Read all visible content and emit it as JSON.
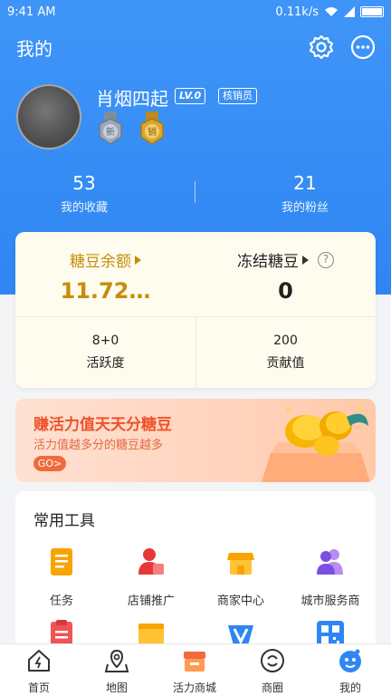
{
  "status": {
    "time": "9:41 AM",
    "network_speed": "0.11k/s"
  },
  "header": {
    "title": "我的",
    "settings_icon": "gear-icon",
    "more_icon": "chat-more-icon"
  },
  "profile": {
    "name": "肖烟四起",
    "level": "LV.0",
    "role": "核销员",
    "medals": [
      {
        "icon": "medal-icon",
        "text": "新",
        "color": "#9aa8b8"
      },
      {
        "icon": "medal-icon",
        "text": "销",
        "color": "#d8a632"
      }
    ]
  },
  "stats": [
    {
      "value": "53",
      "label": "我的收藏"
    },
    {
      "value": "21",
      "label": "我的粉丝"
    }
  ],
  "balance": {
    "sugar_label": "糖豆余额",
    "sugar_value": "11.72…",
    "frozen_label": "冻结糖豆",
    "frozen_value": "0",
    "activity_value": "8+0",
    "activity_label": "活跃度",
    "contribution_value": "200",
    "contribution_label": "贡献值",
    "accent_color": "#c78c0a"
  },
  "promo": {
    "title": "赚活力值天天分糖豆",
    "subtitle": "活力值越多分的糖豆越多",
    "button": "GO>"
  },
  "tools": {
    "title": "常用工具",
    "items": [
      {
        "label": "任务",
        "icon": "task-icon"
      },
      {
        "label": "店铺推广",
        "icon": "shop-promote-icon"
      },
      {
        "label": "商家中心",
        "icon": "merchant-center-icon"
      },
      {
        "label": "城市服务商",
        "icon": "city-service-icon"
      },
      {
        "label": "",
        "icon": "order-list-icon"
      },
      {
        "label": "",
        "icon": "folder-icon"
      },
      {
        "label": "",
        "icon": "v-icon"
      },
      {
        "label": "",
        "icon": "qrcode-icon"
      }
    ]
  },
  "tabbar": {
    "items": [
      {
        "label": "首页",
        "icon": "home-icon"
      },
      {
        "label": "地图",
        "icon": "map-icon"
      },
      {
        "label": "活力商城",
        "icon": "store-icon"
      },
      {
        "label": "商圈",
        "icon": "business-circle-icon"
      },
      {
        "label": "我的",
        "icon": "profile-mascot-icon",
        "active": true
      }
    ]
  },
  "colors": {
    "primary": "#2f86f3",
    "promo_text": "#f0522a"
  }
}
